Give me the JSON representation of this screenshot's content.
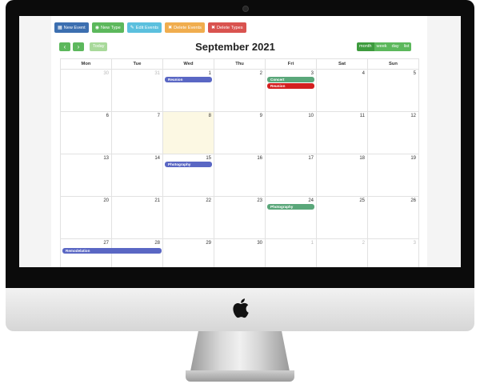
{
  "toolbar": [
    {
      "label": "New Event",
      "icon": "calendar-icon",
      "glyph": "▦",
      "color": "#3c6fb0",
      "name": "new-event-button"
    },
    {
      "label": "New Type",
      "icon": "globe-icon",
      "glyph": "◉",
      "color": "#5cb85c",
      "name": "new-type-button"
    },
    {
      "label": "Edit Events",
      "icon": "edit-icon",
      "glyph": "✎",
      "color": "#5bc0de",
      "name": "edit-events-button"
    },
    {
      "label": "Delete Events",
      "icon": "close-icon",
      "glyph": "✖",
      "color": "#f0ad4e",
      "name": "delete-events-button"
    },
    {
      "label": "Delete Types",
      "icon": "close-icon",
      "glyph": "✖",
      "color": "#d9534f",
      "name": "delete-types-button"
    }
  ],
  "nav": {
    "prev": "‹",
    "next": "›",
    "today": "Today"
  },
  "title": "September 2021",
  "views": [
    "month",
    "week",
    "day",
    "list"
  ],
  "active_view": "month",
  "weekdays": [
    "Mon",
    "Tue",
    "Wed",
    "Thu",
    "Fri",
    "Sat",
    "Sun"
  ],
  "weeks": [
    [
      {
        "n": "30",
        "other": true
      },
      {
        "n": "31",
        "other": true
      },
      {
        "n": "1",
        "events": [
          {
            "label": "Reunion",
            "color": "#5a67c4"
          }
        ]
      },
      {
        "n": "2"
      },
      {
        "n": "3",
        "events": [
          {
            "label": "Concert",
            "color": "#5aa77a"
          },
          {
            "label": "Reunion",
            "color": "#d42020"
          }
        ]
      },
      {
        "n": "4"
      },
      {
        "n": "5"
      }
    ],
    [
      {
        "n": "6"
      },
      {
        "n": "7"
      },
      {
        "n": "8",
        "today": true
      },
      {
        "n": "9"
      },
      {
        "n": "10"
      },
      {
        "n": "11"
      },
      {
        "n": "12"
      }
    ],
    [
      {
        "n": "13"
      },
      {
        "n": "14"
      },
      {
        "n": "15",
        "events": [
          {
            "label": "Photography",
            "color": "#5a67c4"
          }
        ]
      },
      {
        "n": "16"
      },
      {
        "n": "17"
      },
      {
        "n": "18"
      },
      {
        "n": "19"
      }
    ],
    [
      {
        "n": "20"
      },
      {
        "n": "21"
      },
      {
        "n": "22"
      },
      {
        "n": "23"
      },
      {
        "n": "24",
        "events": [
          {
            "label": "Photography",
            "color": "#5aa77a"
          }
        ]
      },
      {
        "n": "25"
      },
      {
        "n": "26"
      }
    ],
    [
      {
        "n": "27"
      },
      {
        "n": "28"
      },
      {
        "n": "29"
      },
      {
        "n": "30"
      },
      {
        "n": "1",
        "other": true
      },
      {
        "n": "2",
        "other": true
      },
      {
        "n": "3",
        "other": true
      }
    ]
  ],
  "multi_day_event": {
    "label": "Remodelation",
    "color": "#5a67c4",
    "week": 4,
    "start_col": 0,
    "span": 2
  }
}
